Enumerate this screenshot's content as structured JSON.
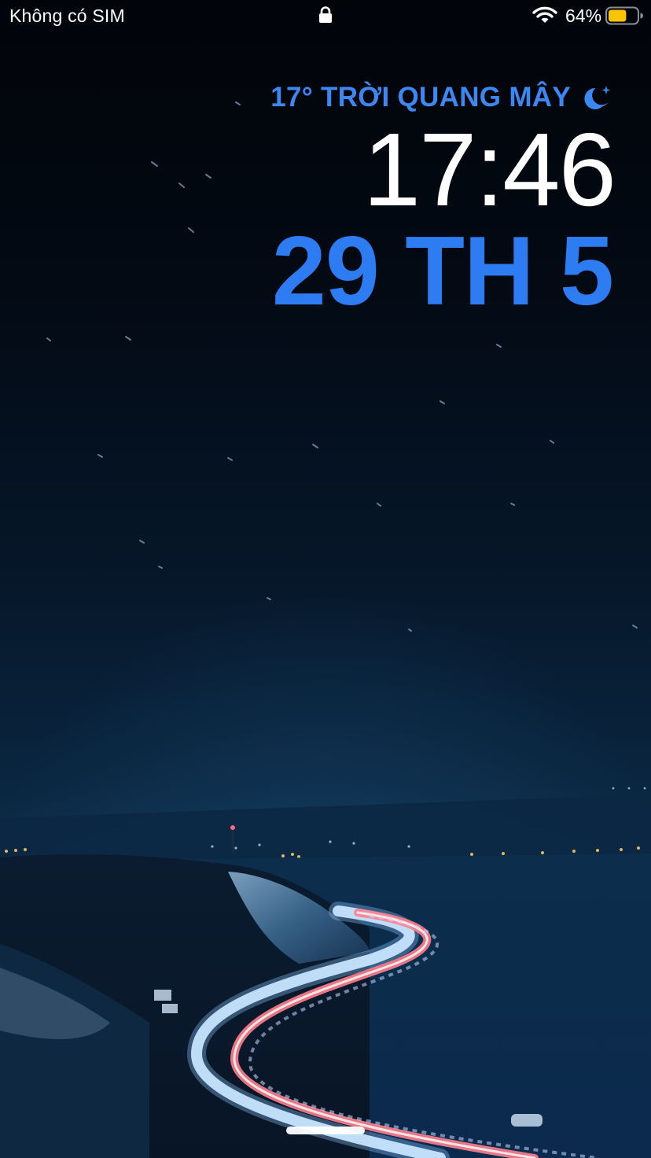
{
  "status_bar": {
    "carrier": "Không có SIM",
    "battery_percent": "64%",
    "battery_level": 0.64,
    "battery_color": "#f7c600",
    "lock_icon": "lock-icon",
    "wifi_icon": "wifi-icon"
  },
  "lock_screen": {
    "weather": {
      "text": "17° TRỜI QUANG MÂY",
      "icon": "moon-stars-icon"
    },
    "time": "17:46",
    "date": "29 TH 5",
    "accent_color": "#2d7cf2",
    "weather_color": "#3d88f0"
  },
  "wallpaper": {
    "description_icon": "night-highway-wallpaper"
  }
}
